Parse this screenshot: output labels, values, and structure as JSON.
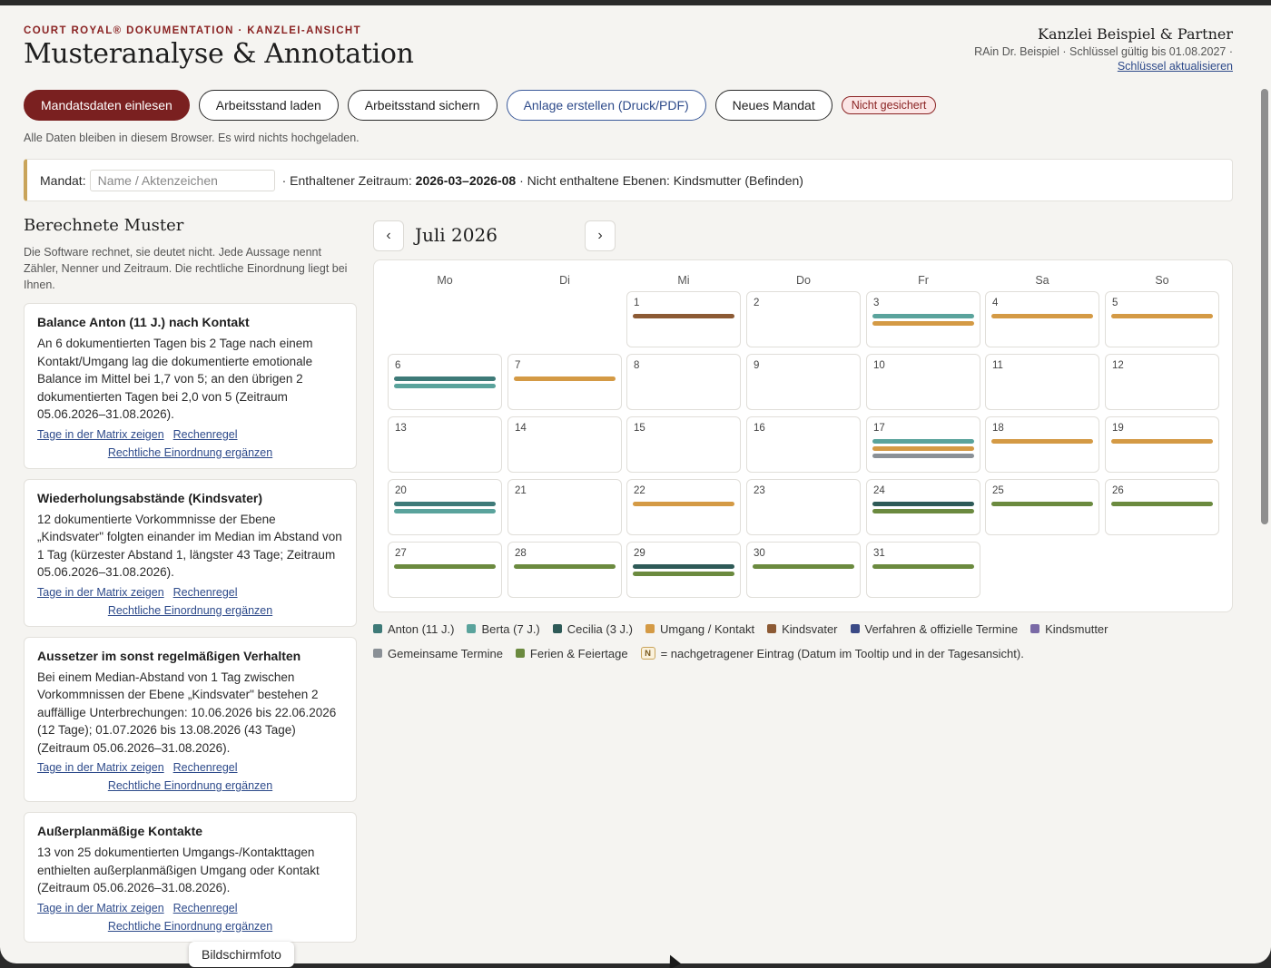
{
  "header": {
    "kicker": "COURT ROYAL® DOKUMENTATION · KANZLEI-ANSICHT",
    "title": "Musteranalyse & Annotation",
    "firm_name": "Kanzlei Beispiel & Partner",
    "firm_sub": "RAin Dr. Beispiel · Schlüssel gültig bis 01.08.2027 ·",
    "firm_link": "Schlüssel aktualisieren"
  },
  "toolbar": {
    "load_mandate": "Mandatsdaten einlesen",
    "load_state": "Arbeitsstand laden",
    "save_state": "Arbeitsstand sichern",
    "create_attachment": "Anlage erstellen (Druck/PDF)",
    "new_mandate": "Neues Mandat",
    "status": "Nicht gesichert",
    "note": "Alle Daten bleiben in diesem Browser. Es wird nichts hochgeladen."
  },
  "mandat": {
    "label": "Mandat:",
    "placeholder": "Name / Aktenzeichen",
    "period_prefix": "· Enthaltener Zeitraum:",
    "period": "2026-03–2026-08",
    "excluded": "· Nicht enthaltene Ebenen: Kindsmutter (Befinden)"
  },
  "patterns": {
    "title": "Berechnete Muster",
    "intro": "Die Software rechnet, sie deutet nicht. Jede Aussage nennt Zähler, Nenner und Zeitraum. Die rechtliche Einordnung liegt bei Ihnen.",
    "link_matrix": "Tage in der Matrix zeigen",
    "link_rule": "Rechenregel",
    "link_legal": "Rechtliche Einordnung ergänzen",
    "cards": [
      {
        "title": "Balance Anton (11 J.) nach Kontakt",
        "text": "An 6 dokumentierten Tagen bis 2 Tage nach einem Kontakt/Umgang lag die dokumentierte emotionale Balance im Mittel bei 1,7 von 5; an den übrigen 2 dokumentierten Tagen bei 2,0 von 5 (Zeitraum 05.06.2026–31.08.2026)."
      },
      {
        "title": "Wiederholungsabstände (Kindsvater)",
        "text": "12 dokumentierte Vorkommnisse der Ebene „Kindsvater\" folgten einander im Median im Abstand von 1 Tag (kürzester Abstand 1, längster 43 Tage; Zeitraum 05.06.2026–31.08.2026)."
      },
      {
        "title": "Aussetzer im sonst regelmäßigen Verhalten",
        "text": "Bei einem Median-Abstand von 1 Tag zwischen Vorkommnissen der Ebene „Kindsvater\" bestehen 2 auffällige Unterbrechungen: 10.06.2026 bis 22.06.2026 (12 Tage); 01.07.2026 bis 13.08.2026 (43 Tage) (Zeitraum 05.06.2026–31.08.2026)."
      },
      {
        "title": "Außerplanmäßige Kontakte",
        "text": "13 von 25 dokumentierten Umgangs-/Kontakttagen enthielten außerplanmäßigen Umgang oder Kontakt (Zeitraum 05.06.2026–31.08.2026)."
      }
    ]
  },
  "calendar": {
    "month": "Juli 2026",
    "prev": "‹",
    "next": "›",
    "weekdays": [
      "Mo",
      "Di",
      "Mi",
      "Do",
      "Fr",
      "Sa",
      "So"
    ],
    "first_weekday_index": 2,
    "colors": {
      "anton": "#3e7a78",
      "berta": "#5aa39c",
      "cecilia": "#2e5a57",
      "umgang": "#d49a45",
      "kindsvater": "#8c5a34",
      "verfahren": "#3b4a86",
      "kindsmutter": "#7a6aa6",
      "gemeinsam": "#8a9096",
      "ferien": "#6b8a3f"
    },
    "days": [
      {
        "d": "1",
        "bars": [
          "kindsvater"
        ]
      },
      {
        "d": "2",
        "bars": []
      },
      {
        "d": "3",
        "bars": [
          "berta",
          "umgang"
        ]
      },
      {
        "d": "4",
        "bars": [
          "umgang"
        ]
      },
      {
        "d": "5",
        "bars": [
          "umgang"
        ]
      },
      {
        "d": "6",
        "bars": [
          "anton",
          "berta"
        ]
      },
      {
        "d": "7",
        "bars": [
          "umgang"
        ]
      },
      {
        "d": "8",
        "bars": []
      },
      {
        "d": "9",
        "bars": []
      },
      {
        "d": "10",
        "bars": []
      },
      {
        "d": "11",
        "bars": []
      },
      {
        "d": "12",
        "bars": []
      },
      {
        "d": "13",
        "bars": []
      },
      {
        "d": "14",
        "bars": []
      },
      {
        "d": "15",
        "bars": []
      },
      {
        "d": "16",
        "bars": []
      },
      {
        "d": "17",
        "bars": [
          "berta",
          "umgang",
          "gemeinsam"
        ]
      },
      {
        "d": "18",
        "bars": [
          "umgang"
        ]
      },
      {
        "d": "19",
        "bars": [
          "umgang"
        ]
      },
      {
        "d": "20",
        "bars": [
          "anton",
          "berta"
        ]
      },
      {
        "d": "21",
        "bars": []
      },
      {
        "d": "22",
        "bars": [
          "umgang"
        ]
      },
      {
        "d": "23",
        "bars": []
      },
      {
        "d": "24",
        "bars": [
          "cecilia",
          "ferien"
        ]
      },
      {
        "d": "25",
        "bars": [
          "ferien"
        ]
      },
      {
        "d": "26",
        "bars": [
          "ferien"
        ]
      },
      {
        "d": "27",
        "bars": [
          "ferien"
        ]
      },
      {
        "d": "28",
        "bars": [
          "ferien"
        ]
      },
      {
        "d": "29",
        "bars": [
          "cecilia",
          "ferien"
        ]
      },
      {
        "d": "30",
        "bars": [
          "ferien"
        ]
      },
      {
        "d": "31",
        "bars": [
          "ferien"
        ]
      }
    ]
  },
  "legend": {
    "row1": [
      {
        "key": "anton",
        "label": "Anton (11 J.)"
      },
      {
        "key": "berta",
        "label": "Berta (7 J.)"
      },
      {
        "key": "cecilia",
        "label": "Cecilia (3 J.)"
      },
      {
        "key": "umgang",
        "label": "Umgang / Kontakt"
      },
      {
        "key": "kindsvater",
        "label": "Kindsvater"
      },
      {
        "key": "verfahren",
        "label": "Verfahren & offizielle Termine"
      },
      {
        "key": "kindsmutter",
        "label": "Kindsmutter"
      }
    ],
    "row2": [
      {
        "key": "gemeinsam",
        "label": "Gemeinsame Termine"
      },
      {
        "key": "ferien",
        "label": "Ferien & Feiertage"
      }
    ],
    "n_badge": "N",
    "n_text": "= nachgetragener Eintrag (Datum im Tooltip und in der Tagesansicht)."
  },
  "overlay": {
    "tooltip": "Bildschirmfoto"
  }
}
